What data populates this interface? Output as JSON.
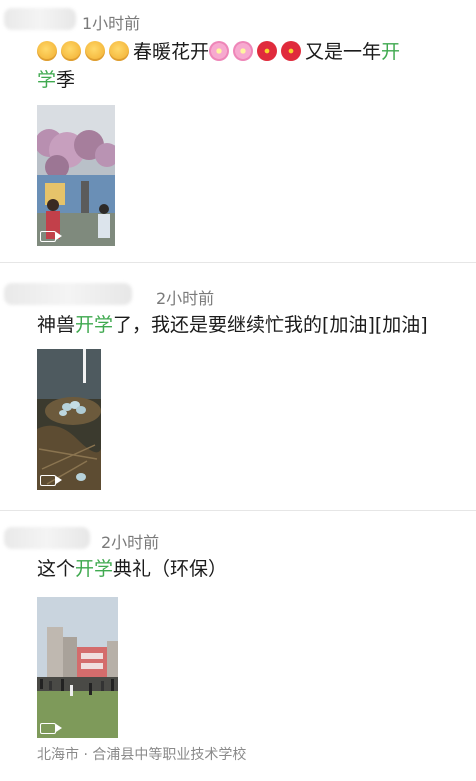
{
  "posts": [
    {
      "time": "1小时前",
      "text_a": "春暖花开",
      "text_b": "又是一年",
      "text_hl_1": "开",
      "text_hl_2": "学",
      "text_c": "季",
      "emojis": [
        "shushing-face-icon",
        "shushing-face-icon",
        "shushing-face-icon",
        "shushing-face-icon"
      ],
      "flowers": [
        "cherry-blossom-icon",
        "cherry-blossom-icon",
        "hibiscus-icon",
        "hibiscus-icon"
      ]
    },
    {
      "time": "2小时前",
      "text_a": "神兽",
      "text_hl": "开学",
      "text_b": "了，我还是要继续忙我的[加油][加油]"
    },
    {
      "time": "2小时前",
      "text_a": "这个",
      "text_hl": "开学",
      "text_b": "典礼（环保）",
      "location": "北海市 · 合浦县中等职业技术学校"
    }
  ],
  "colors": {
    "highlight": "#3fa94f",
    "time": "#7a7a7a",
    "divider": "#e6e6e6"
  }
}
